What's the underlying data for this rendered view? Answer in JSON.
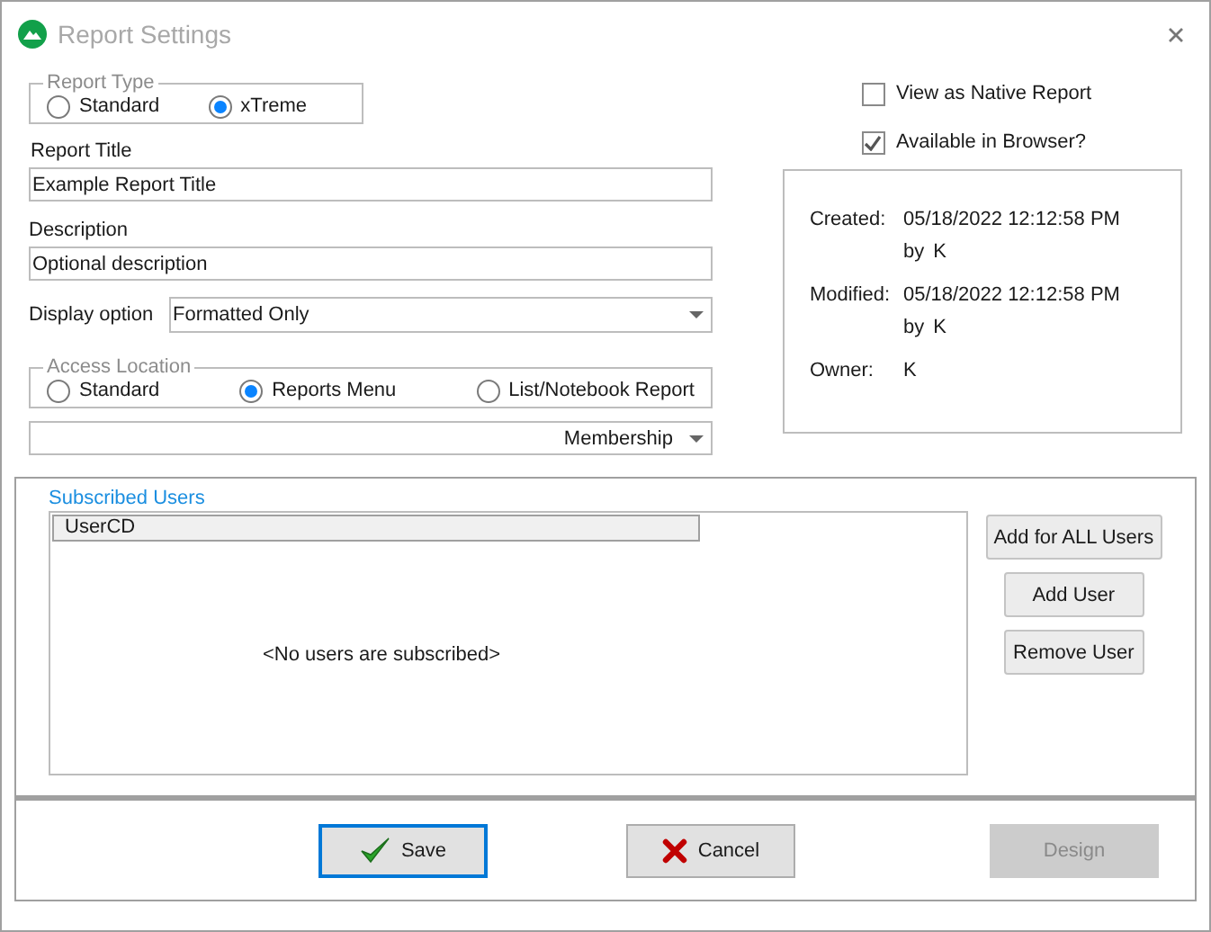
{
  "window": {
    "title": "Report Settings"
  },
  "report_type": {
    "legend": "Report Type",
    "options": [
      {
        "label": "Standard",
        "selected": false
      },
      {
        "label": "xTreme",
        "selected": true
      }
    ]
  },
  "report_title": {
    "label": "Report Title",
    "value": "Example Report Title"
  },
  "description": {
    "label": "Description",
    "value": "Optional description"
  },
  "display_option": {
    "label": "Display option",
    "value": "Formatted Only"
  },
  "access_location": {
    "legend": "Access Location",
    "options": [
      {
        "label": "Standard",
        "selected": false
      },
      {
        "label": "Reports Menu",
        "selected": true
      },
      {
        "label": "List/Notebook Report",
        "selected": false
      }
    ]
  },
  "menu_dropdown": {
    "value": "Membership"
  },
  "options": [
    {
      "label": "View as Native Report",
      "checked": false
    },
    {
      "label": "Available in Browser?",
      "checked": true
    }
  ],
  "info": [
    {
      "label": "Created:",
      "value": "05/18/2022 12:12:58 PM",
      "by": "by",
      "user": "K"
    },
    {
      "label": "Modified:",
      "value": "05/18/2022 12:12:58 PM",
      "by": "by",
      "user": "K"
    },
    {
      "label": "Owner:",
      "value": "K"
    }
  ],
  "subscribed_users": {
    "title": "Subscribed Users",
    "columns": [
      "UserCD"
    ],
    "empty_text": "<No users are subscribed>",
    "buttons": [
      "Add for ALL Users",
      "Add User",
      "Remove User"
    ]
  },
  "footer_buttons": [
    {
      "label": "Save",
      "kind": "save",
      "focused": true,
      "disabled": false
    },
    {
      "label": "Cancel",
      "kind": "cancel",
      "focused": false,
      "disabled": false
    },
    {
      "label": "Design",
      "kind": "plain",
      "focused": false,
      "disabled": true
    }
  ]
}
